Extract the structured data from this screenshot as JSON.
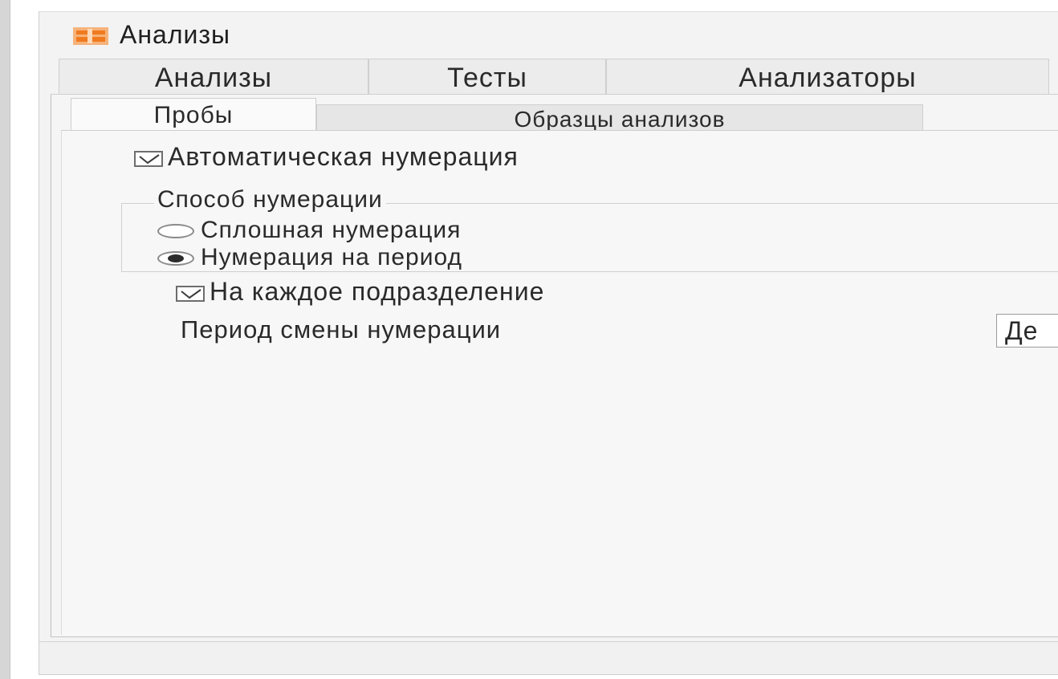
{
  "window": {
    "title": "Анализы",
    "icon": "app-icon"
  },
  "outer_tabs": [
    {
      "label": "Анализы"
    },
    {
      "label": "Тесты"
    },
    {
      "label": "Анализаторы"
    }
  ],
  "inner_tabs": [
    {
      "label": "Пробы",
      "active": true
    },
    {
      "label": "Образцы анализов",
      "active": false
    }
  ],
  "settings": {
    "auto_numbering": {
      "label": "Автоматическая нумерация",
      "checked": true
    },
    "numbering_method": {
      "legend": "Способ нумерации",
      "options": [
        {
          "label": "Сплошная нумерация",
          "selected": false
        },
        {
          "label": "Нумерация на период",
          "selected": true
        }
      ]
    },
    "per_department": {
      "label": "На каждое подразделение",
      "checked": true
    },
    "period_change": {
      "label": "Период смены нумерации",
      "value": "Де"
    }
  },
  "colors": {
    "icon_orange": "#f07a1e",
    "icon_light": "#f6b27a"
  }
}
